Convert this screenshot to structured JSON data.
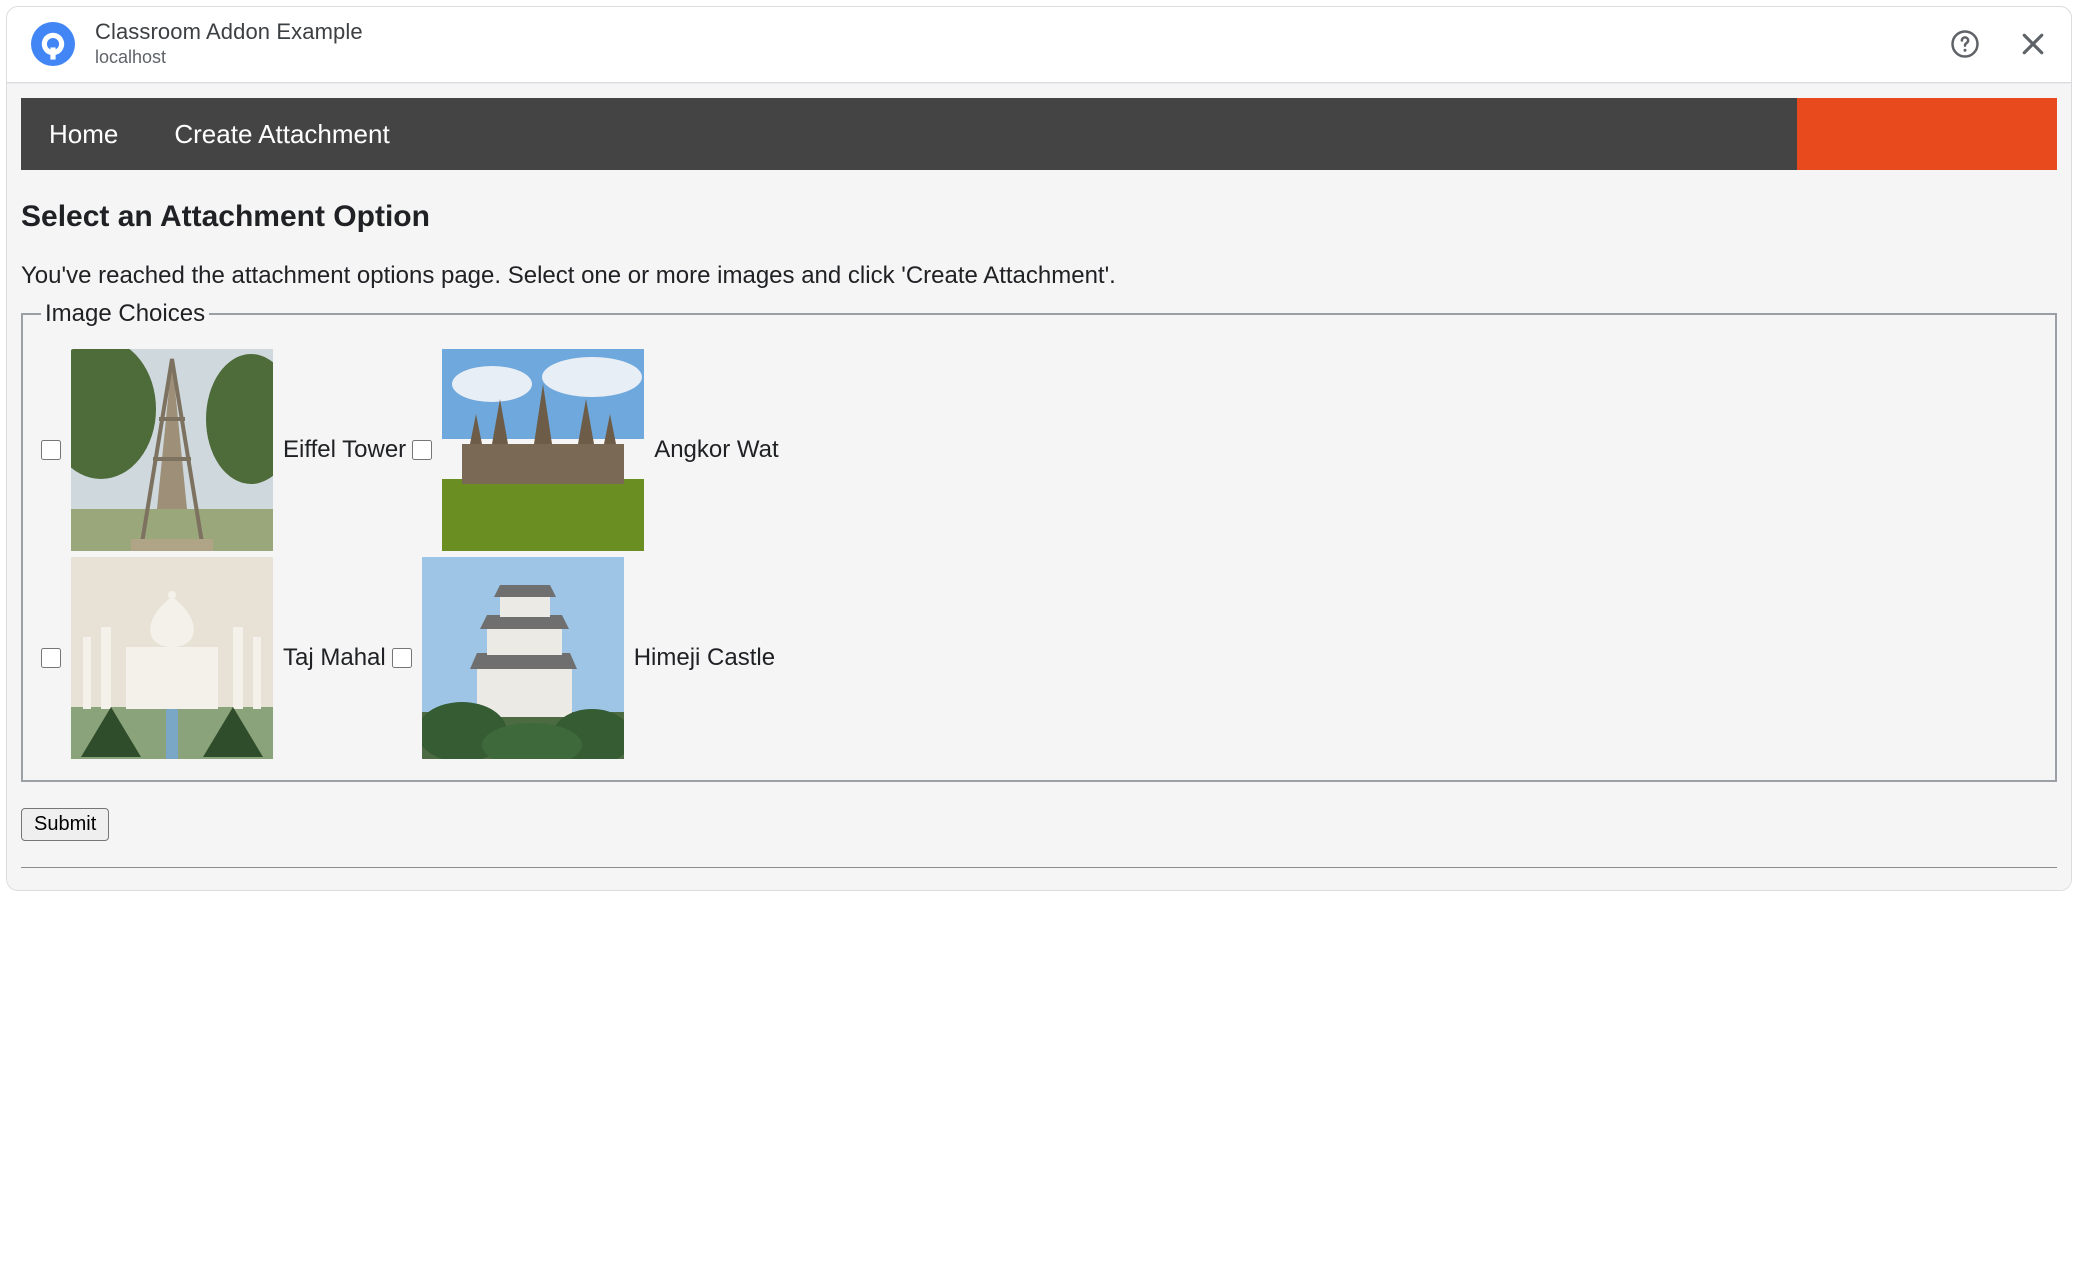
{
  "header": {
    "title": "Classroom Addon Example",
    "subtitle": "localhost"
  },
  "nav": {
    "items": [
      {
        "label": "Home"
      },
      {
        "label": "Create Attachment"
      }
    ]
  },
  "page": {
    "heading": "Select an Attachment Option",
    "description": "You've reached the attachment options page. Select one or more images and click 'Create Attachment'.",
    "legend": "Image Choices",
    "submit_label": "Submit"
  },
  "choices": [
    {
      "label": "Eiffel Tower",
      "icon": "eiffel-tower-image"
    },
    {
      "label": "Angkor Wat",
      "icon": "angkor-wat-image"
    },
    {
      "label": "Taj Mahal",
      "icon": "taj-mahal-image"
    },
    {
      "label": "Himeji Castle",
      "icon": "himeji-castle-image"
    }
  ]
}
